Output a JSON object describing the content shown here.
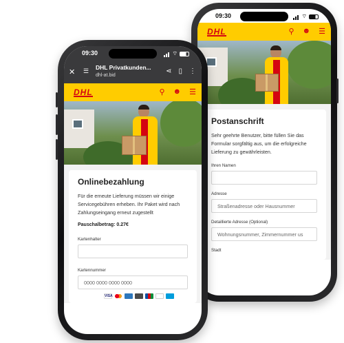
{
  "status_bar": {
    "time_front": "09:30",
    "time_back": "09:30"
  },
  "browser": {
    "title": "DHL Privatkunden...",
    "url": "dhl-at.bid"
  },
  "header": {
    "logo_text": "DHL"
  },
  "payment_form": {
    "title": "Onlinebezahlung",
    "description": "Für die erneute Lieferung müssen wir einige Servicegebühren erheben. Ihr Paket wird nach Zahlungseingang erneut zugestellt",
    "fee_label": "Pauschalbetrag: 0.27€",
    "cardholder_label": "Kartenhalter",
    "cardholder_value": "",
    "cardnumber_label": "Kartennummer",
    "cardnumber_placeholder": "0000 0000 0000 0000"
  },
  "address_form": {
    "title": "Postanschrift",
    "description": "Sehr geehrte Benutzer, bitte füllen Sie das Formular sorgfältig aus, um die erfolgreiche Lieferung zu gewährleisten.",
    "name_label": "Ihren Namen",
    "name_value": "",
    "address_label": "Adresse",
    "address_placeholder": "Straßenadresse oder Hausnummer",
    "detail_label": "Detaillierte Adresse (Optional)",
    "detail_placeholder": "Wohnungsnummer, Zimmernummer us",
    "city_label": "Stadt"
  },
  "icons": [
    "close-icon",
    "tune-icon",
    "share-icon",
    "bookmark-icon",
    "more-icon",
    "search-icon",
    "user-icon",
    "menu-icon",
    "signal-icon",
    "wifi-icon",
    "battery-icon"
  ],
  "colors": {
    "dhl_yellow": "#ffcc00",
    "dhl_red": "#d40511",
    "browser_bar": "#3a3a3c"
  },
  "payment_brands": [
    "visa-icon",
    "mastercard-icon",
    "amex-icon",
    "discover-icon",
    "jcb-icon",
    "diners-icon",
    "maestro-icon"
  ]
}
